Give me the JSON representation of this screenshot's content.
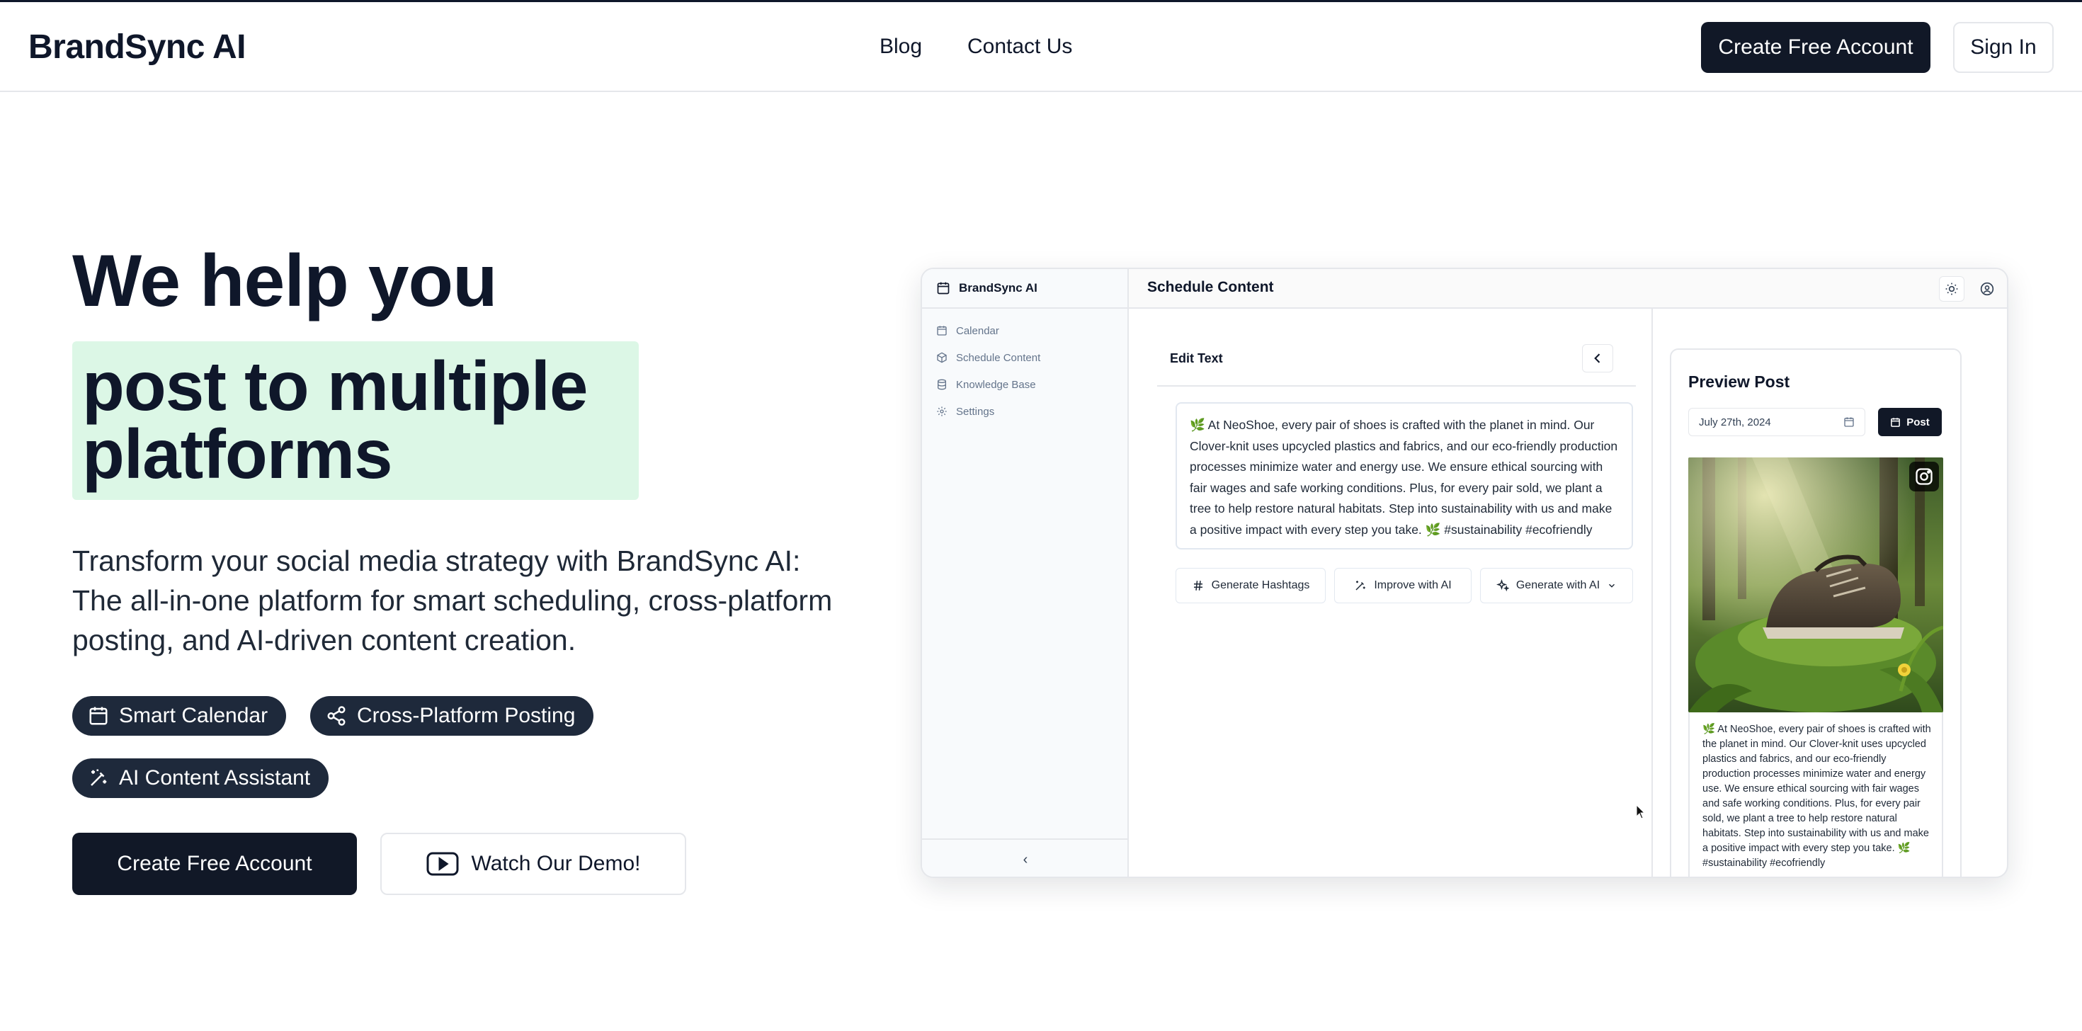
{
  "nav": {
    "brand": "BrandSync AI",
    "links": [
      "Blog",
      "Contact Us"
    ],
    "create_account": "Create Free Account",
    "sign_in": "Sign In"
  },
  "hero": {
    "headline_1": "We help you",
    "headline_2": "post to multiple platforms",
    "subtitle": "Transform your social media strategy with BrandSync AI: The all-in-one platform for smart scheduling, cross-platform posting, and AI-driven content creation.",
    "pills": [
      "Smart Calendar",
      "Cross-Platform Posting",
      "AI Content Assistant"
    ],
    "cta_primary": "Create Free Account",
    "cta_secondary": "Watch Our Demo!",
    "highlight_color": "#dcf7e6"
  },
  "app": {
    "brand": "BrandSync AI",
    "sidebar": [
      "Calendar",
      "Schedule Content",
      "Knowledge Base",
      "Settings"
    ],
    "collapse_glyph": "‹",
    "page_title": "Schedule Content",
    "edit": {
      "title": "Edit Text",
      "text": "🌿 At NeoShoe, every pair of shoes is crafted with the planet in mind. Our Clover-knit uses upcycled plastics and fabrics, and our eco-friendly production processes minimize water and energy use. We ensure ethical sourcing with fair wages and safe working conditions. Plus, for every pair sold, we plant a tree to help restore natural habitats. Step into sustainability with us and make a positive impact with every step you take. 🌿 #sustainability #ecofriendly",
      "buttons": [
        "Generate Hashtags",
        "Improve with AI",
        "Generate with AI"
      ]
    },
    "preview": {
      "title": "Preview Post",
      "date": "July 27th, 2024",
      "post_button": "Post",
      "platform_icon": "instagram-icon",
      "caption": "🌿 At NeoShoe, every pair of shoes is crafted with the planet in mind. Our Clover-knit uses upcycled plastics and fabrics, and our eco-friendly production processes minimize water and energy use. We ensure ethical sourcing with fair wages and safe working conditions. Plus, for every pair sold, we plant a tree to help restore natural habitats. Step into sustainability with us and make a positive impact with every step you take. 🌿 #sustainability #ecofriendly"
    }
  }
}
